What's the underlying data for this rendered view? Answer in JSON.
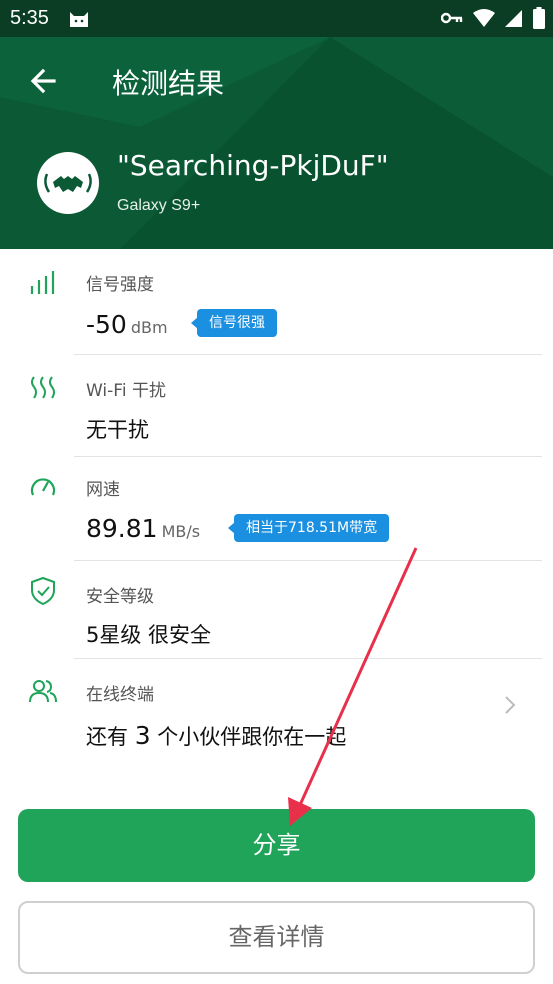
{
  "status": {
    "time": "5:35"
  },
  "header": {
    "title": "检测结果",
    "ssid": "\"Searching-PkjDuF\"",
    "device": "Galaxy S9+"
  },
  "signal": {
    "label": "信号强度",
    "value": "-50",
    "unit": "dBm",
    "tag": "信号很强"
  },
  "interference": {
    "label": "Wi-Fi 干扰",
    "value": "无干扰"
  },
  "speed": {
    "label": "网速",
    "value": "89.81",
    "unit": "MB/s",
    "tag": "相当于718.51M带宽"
  },
  "security": {
    "label": "安全等级",
    "value": "5星级 很安全"
  },
  "devices": {
    "label": "在线终端",
    "prefix": "还有 ",
    "count": "3",
    "suffix": " 个小伙伴跟你在一起"
  },
  "buttons": {
    "share": "分享",
    "details": "查看详情"
  },
  "colors": {
    "header": "#0b5a35",
    "accent": "#1fa45a",
    "tag": "#1b8fe0",
    "annotation": "#e8304a"
  }
}
